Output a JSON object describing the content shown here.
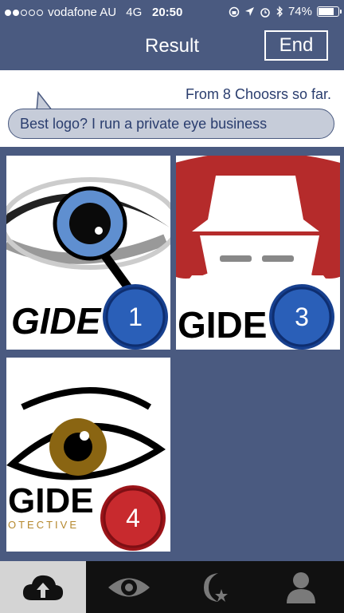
{
  "status_bar": {
    "carrier": "vodafone AU",
    "network": "4G",
    "time": "20:50",
    "battery": "74%",
    "battery_level": 0.74
  },
  "nav": {
    "title": "Result",
    "end_label": "End"
  },
  "question": {
    "count_text": "From 8 Choosrs so far.",
    "text": "Best logo? I run a private eye business"
  },
  "results": [
    {
      "rank": "1",
      "brand_text": "GIDE",
      "badge_color": "blue"
    },
    {
      "rank": "3",
      "brand_text": "GIDE",
      "badge_color": "blue"
    },
    {
      "rank": "4",
      "brand_text": "GIDE",
      "subtext": "OTECTIVE",
      "badge_color": "red"
    }
  ],
  "colors": {
    "header": "#4a5a80",
    "badge_blue": "#1f4f9e",
    "badge_red": "#b51c22",
    "tabbar": "#111111",
    "tab_active": "#d4d4d4"
  },
  "tabs": [
    {
      "icon": "cloud-upload-icon",
      "active": true
    },
    {
      "icon": "eye-icon",
      "active": false
    },
    {
      "icon": "moon-star-icon",
      "active": false
    },
    {
      "icon": "person-icon",
      "active": false
    }
  ]
}
